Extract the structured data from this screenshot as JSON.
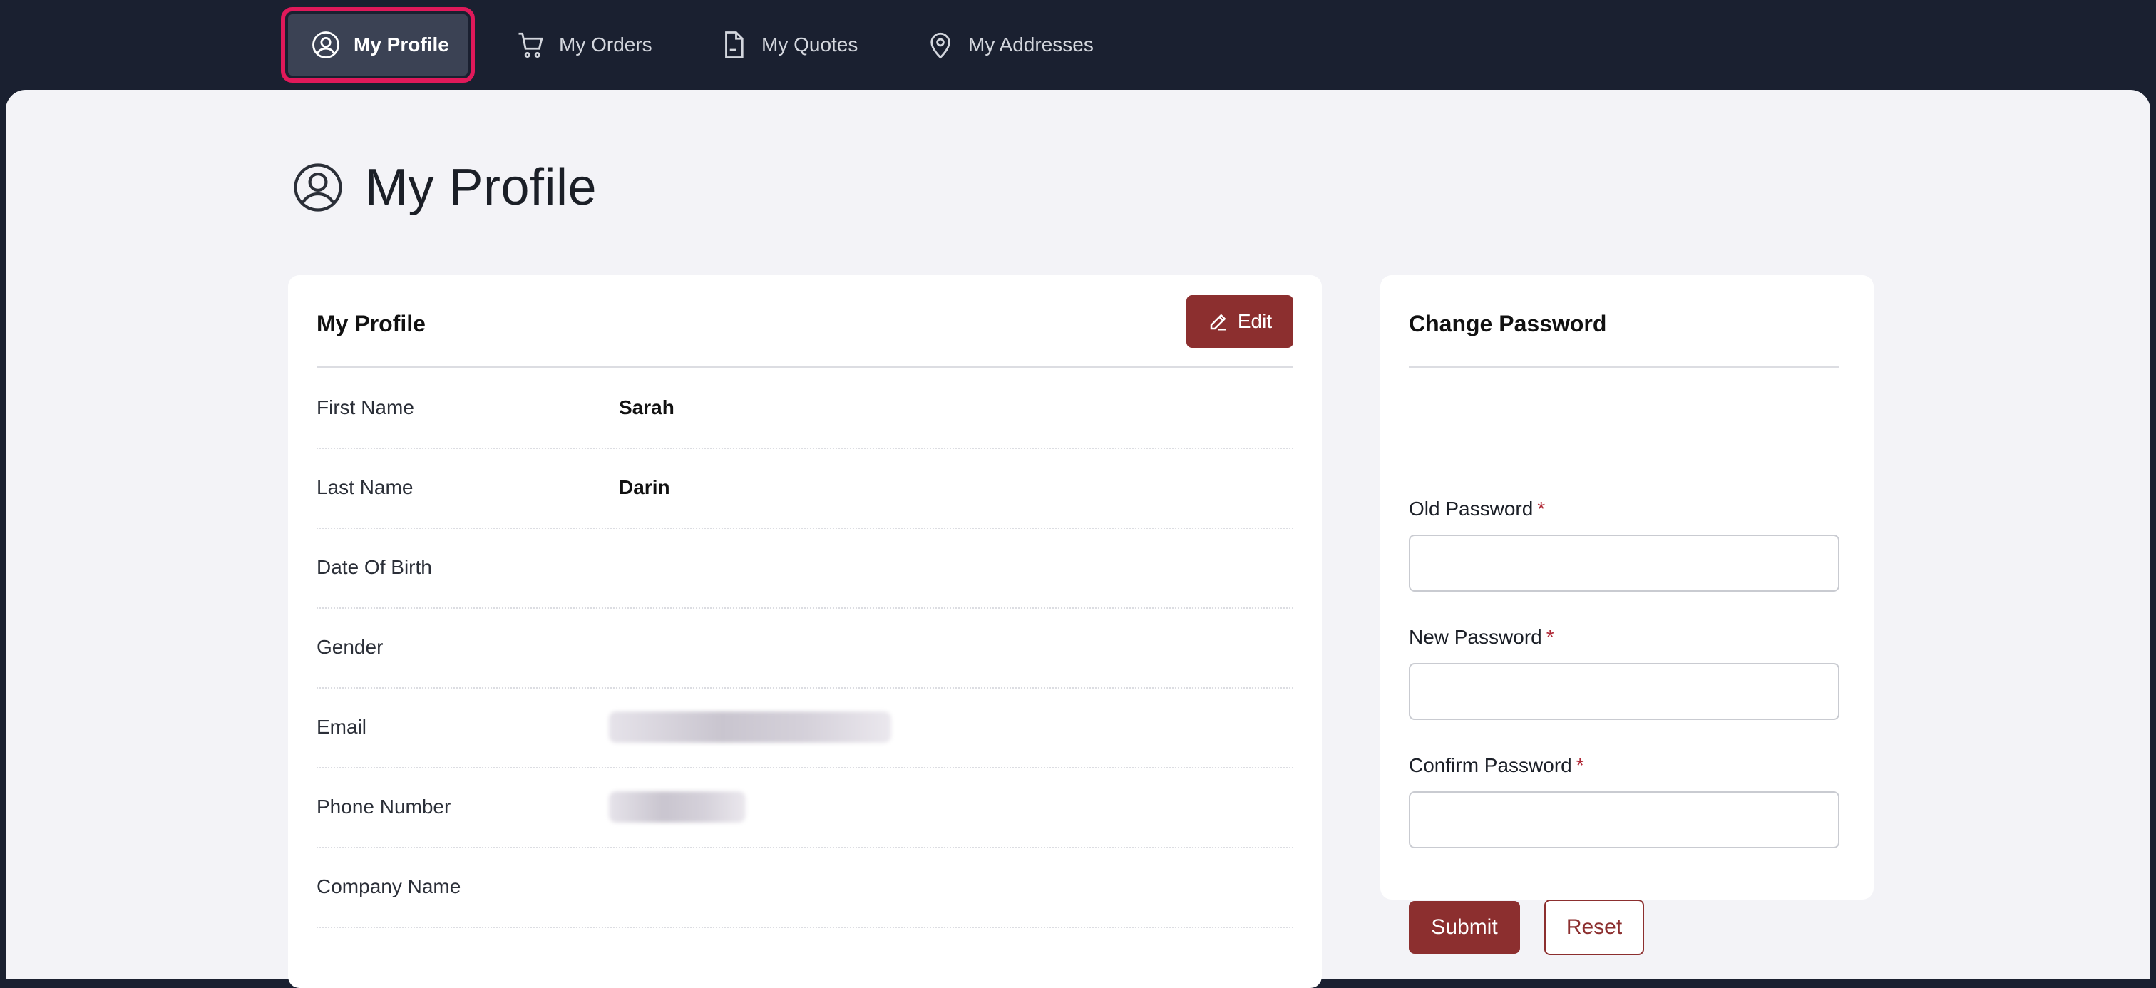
{
  "nav": {
    "items": [
      {
        "label": "My Profile",
        "icon": "user-circle-icon",
        "active": true
      },
      {
        "label": "My Orders",
        "icon": "cart-icon",
        "active": false
      },
      {
        "label": "My Quotes",
        "icon": "document-icon",
        "active": false
      },
      {
        "label": "My Addresses",
        "icon": "map-pin-icon",
        "active": false
      }
    ]
  },
  "page": {
    "title": "My Profile",
    "title_icon": "user-circle-icon"
  },
  "profile_card": {
    "title": "My Profile",
    "edit_label": "Edit",
    "fields": [
      {
        "label": "First Name",
        "value": "Sarah"
      },
      {
        "label": "Last Name",
        "value": "Darin"
      },
      {
        "label": "Date Of Birth",
        "value": ""
      },
      {
        "label": "Gender",
        "value": ""
      },
      {
        "label": "Email",
        "value": ""
      },
      {
        "label": "Phone Number",
        "value": ""
      },
      {
        "label": "Company Name",
        "value": ""
      }
    ]
  },
  "password_card": {
    "title": "Change Password",
    "old_label": "Old Password",
    "new_label": "New Password",
    "confirm_label": "Confirm Password",
    "required_mark": "*",
    "submit_label": "Submit",
    "reset_label": "Reset"
  },
  "colors": {
    "nav_bg": "#1a2030",
    "accent": "#8c2f2f",
    "highlight": "#e0195a",
    "page_bg": "#f3f3f7"
  }
}
